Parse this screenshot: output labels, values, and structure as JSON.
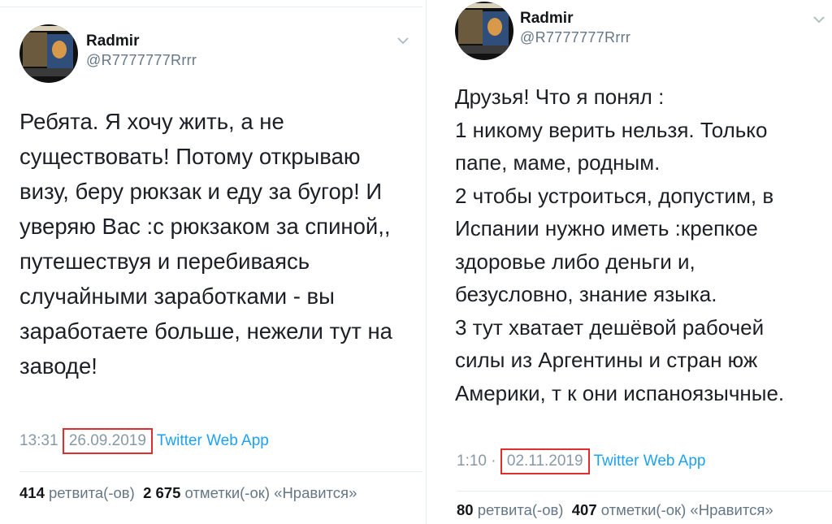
{
  "tweets": [
    {
      "author_name": "Radmir",
      "handle": "@R7777777Rrrr",
      "text_lines": [
        "Ребята. Я хочу жить, а не",
        "существовать! Потому открываю",
        "визу, беру рюкзак и еду за бугор! И",
        "уверяю Вас :с рюкзаком за спиной,,",
        "путешествуя и перебиваясь",
        "случайными заработками - вы",
        "заработаете больше, нежели тут на",
        "заводе!"
      ],
      "time": "13:31",
      "separator": " ",
      "date": "26.09.2019",
      "source": "Twitter Web App",
      "retweets_count": "414",
      "retweets_label": "ретвита(-ов)",
      "likes_count": "2 675",
      "likes_label": "отметки(-ок) «Нравится»"
    },
    {
      "author_name": "Radmir",
      "handle": "@R7777777Rrrr",
      "text_lines": [
        "Друзья! Что я понял :",
        "1 никому верить нельзя.  Только",
        "папе, маме, родным.",
        "2 чтобы устроиться, допустим, в",
        "Испании нужно иметь :крепкое",
        "здоровье либо деньги и,",
        "безусловно, знание языка.",
        "3 тут хватает дешёвой рабочей",
        "силы из Аргентины и стран юж",
        "Америки, т к они испаноязычные."
      ],
      "time": "1:10",
      "separator": " · ",
      "date": "02.11.2019",
      "source": "Twitter Web App",
      "retweets_count": "80",
      "retweets_label": "ретвита(-ов)",
      "likes_count": "407",
      "likes_label": "отметки(-ок) «Нравится»"
    }
  ],
  "icons": {
    "menu": "chevron-down-icon",
    "avatar": "avatar-image"
  },
  "colors": {
    "highlight_box": "#e02d2d",
    "link": "#1da1f2",
    "muted": "#8899a6"
  }
}
